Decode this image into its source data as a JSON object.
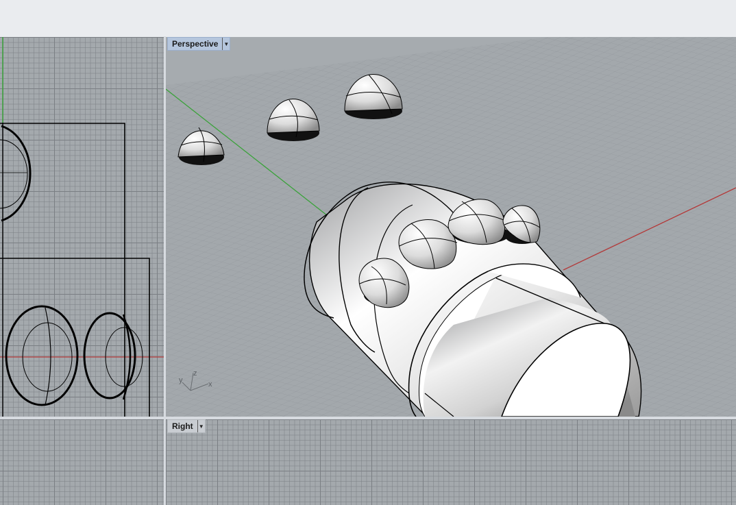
{
  "viewports": {
    "perspective": {
      "label": "Perspective",
      "dropdown_icon": "triangle-down-icon"
    },
    "right": {
      "label": "Right",
      "dropdown_icon": "triangle-down-icon"
    }
  },
  "axis_gizmo": {
    "x": "x",
    "y": "y",
    "z": "z"
  },
  "colors": {
    "x_axis": "#b33a3a",
    "y_axis": "#3aa23a",
    "active_tab": "#b5c6dd",
    "viewport_bg": "#a4a9ad"
  }
}
